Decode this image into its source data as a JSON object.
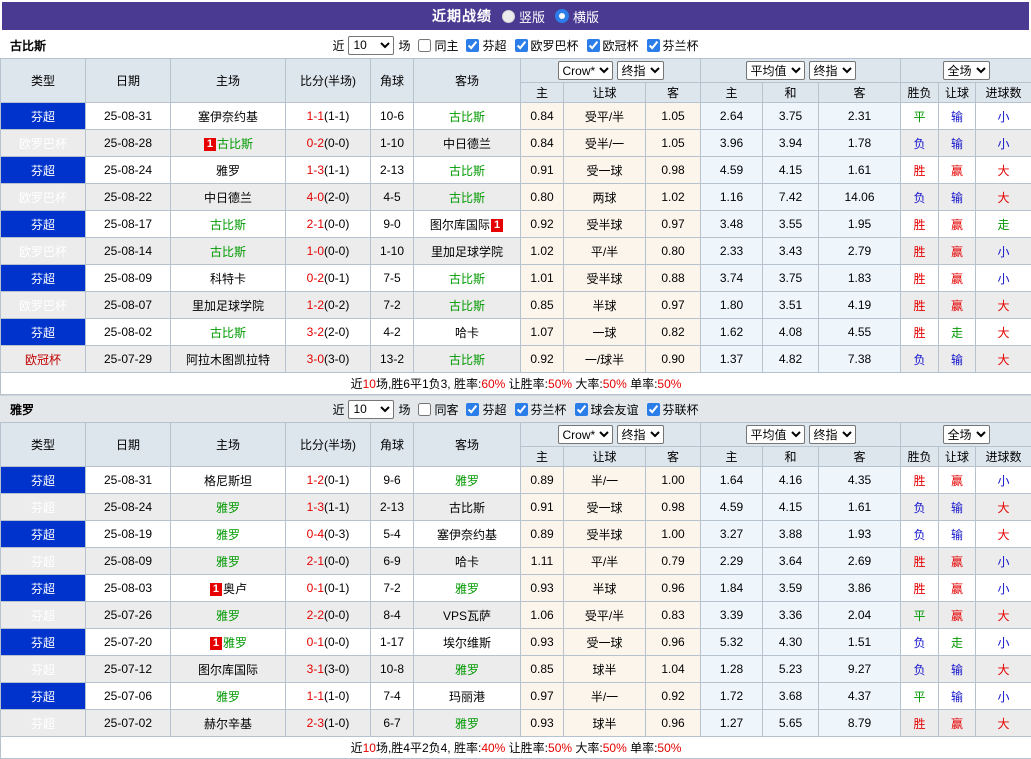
{
  "title_bar": {
    "title": "近期战绩",
    "radios": [
      {
        "label": "竖版",
        "selected": false
      },
      {
        "label": "横版",
        "selected": true
      }
    ]
  },
  "table_headers": {
    "left": [
      "类型",
      "日期",
      "主场",
      "比分(半场)",
      "角球",
      "客场"
    ],
    "groups": [
      {
        "selects": [
          "Crow*",
          "终指"
        ],
        "cols": [
          "主",
          "让球",
          "客"
        ],
        "tint": "crow"
      },
      {
        "selects": [
          "平均值",
          "终指"
        ],
        "cols": [
          "主",
          "和",
          "客"
        ],
        "tint": "avg"
      },
      {
        "selects": [
          "全场"
        ],
        "cols": [
          "胜负",
          "让球",
          "进球数"
        ],
        "tint": "plain"
      }
    ]
  },
  "colors": {
    "header_purple": "#4a3a91",
    "win_red": "#e60000",
    "lose_blue": "#1414cc",
    "draw_green": "#009900",
    "team_green": "#009900",
    "type_fincup_blue": "#0033cc",
    "type_europa_purple": "#7d00e0",
    "type_ucl_orange": "#ff4800"
  },
  "type_colors": {
    "芬超": "blue",
    "欧罗巴杯": "purple",
    "欧冠杯": "orange",
    "芬兰杯": "blue"
  },
  "result_colors": {
    "胜": "red",
    "赢": "red",
    "大": "red",
    "负": "blue",
    "输": "blue",
    "小": "blue",
    "平": "green",
    "走": "green"
  },
  "sections": [
    {
      "team": "古比斯",
      "filter": {
        "near": "近",
        "count": "10",
        "games": "场",
        "same": "同主",
        "same_checked": false,
        "leagues": [
          "芬超",
          "欧罗巴杯",
          "欧冠杯",
          "芬兰杯"
        ]
      },
      "rows": [
        {
          "type": "芬超",
          "date": "25-08-31",
          "home": {
            "text": "塞伊奈约基"
          },
          "score": {
            "ft": "1-1",
            "ht": "(1-1)"
          },
          "corner": "10-6",
          "away": {
            "text": "古比斯",
            "green": true
          },
          "crow": [
            "0.84",
            "受平/半",
            "1.05"
          ],
          "avg": [
            "2.64",
            "3.75",
            "2.31"
          ],
          "result": [
            "平",
            "输",
            "小"
          ]
        },
        {
          "type": "欧罗巴杯",
          "date": "25-08-28",
          "home": {
            "badge_before": "1",
            "text": "古比斯",
            "green": true
          },
          "score": {
            "ft": "0-2",
            "ht": "(0-0)"
          },
          "corner": "1-10",
          "away": {
            "text": "中日德兰"
          },
          "crow": [
            "0.84",
            "受半/一",
            "1.05"
          ],
          "avg": [
            "3.96",
            "3.94",
            "1.78"
          ],
          "result": [
            "负",
            "输",
            "小"
          ]
        },
        {
          "type": "芬超",
          "date": "25-08-24",
          "home": {
            "text": "雅罗"
          },
          "score": {
            "ft": "1-3",
            "ht": "(1-1)"
          },
          "corner": "2-13",
          "away": {
            "text": "古比斯",
            "green": true
          },
          "crow": [
            "0.91",
            "受一球",
            "0.98"
          ],
          "avg": [
            "4.59",
            "4.15",
            "1.61"
          ],
          "result": [
            "胜",
            "赢",
            "大"
          ]
        },
        {
          "type": "欧罗巴杯",
          "date": "25-08-22",
          "home": {
            "text": "中日德兰"
          },
          "score": {
            "ft": "4-0",
            "ht": "(2-0)"
          },
          "corner": "4-5",
          "away": {
            "text": "古比斯",
            "green": true
          },
          "crow": [
            "0.80",
            "两球",
            "1.02"
          ],
          "avg": [
            "1.16",
            "7.42",
            "14.06"
          ],
          "result": [
            "负",
            "输",
            "大"
          ]
        },
        {
          "type": "芬超",
          "date": "25-08-17",
          "home": {
            "text": "古比斯",
            "green": true
          },
          "score": {
            "ft": "2-1",
            "ht": "(0-0)"
          },
          "corner": "9-0",
          "away": {
            "text": "图尔库国际",
            "badge_after": "1"
          },
          "crow": [
            "0.92",
            "受半球",
            "0.97"
          ],
          "avg": [
            "3.48",
            "3.55",
            "1.95"
          ],
          "result": [
            "胜",
            "赢",
            "走"
          ]
        },
        {
          "type": "欧罗巴杯",
          "date": "25-08-14",
          "home": {
            "text": "古比斯",
            "green": true
          },
          "score": {
            "ft": "1-0",
            "ht": "(0-0)"
          },
          "corner": "1-10",
          "away": {
            "text": "里加足球学院"
          },
          "crow": [
            "1.02",
            "平/半",
            "0.80"
          ],
          "avg": [
            "2.33",
            "3.43",
            "2.79"
          ],
          "result": [
            "胜",
            "赢",
            "小"
          ]
        },
        {
          "type": "芬超",
          "date": "25-08-09",
          "home": {
            "text": "科特卡"
          },
          "score": {
            "ft": "0-2",
            "ht": "(0-1)"
          },
          "corner": "7-5",
          "away": {
            "text": "古比斯",
            "green": true
          },
          "crow": [
            "1.01",
            "受半球",
            "0.88"
          ],
          "avg": [
            "3.74",
            "3.75",
            "1.83"
          ],
          "result": [
            "胜",
            "赢",
            "小"
          ]
        },
        {
          "type": "欧罗巴杯",
          "date": "25-08-07",
          "home": {
            "text": "里加足球学院"
          },
          "score": {
            "ft": "1-2",
            "ht": "(0-2)"
          },
          "corner": "7-2",
          "away": {
            "text": "古比斯",
            "green": true
          },
          "crow": [
            "0.85",
            "半球",
            "0.97"
          ],
          "avg": [
            "1.80",
            "3.51",
            "4.19"
          ],
          "result": [
            "胜",
            "赢",
            "大"
          ]
        },
        {
          "type": "芬超",
          "date": "25-08-02",
          "home": {
            "text": "古比斯",
            "green": true
          },
          "score": {
            "ft": "3-2",
            "ht": "(2-0)"
          },
          "corner": "4-2",
          "away": {
            "text": "哈卡"
          },
          "crow": [
            "1.07",
            "一球",
            "0.82"
          ],
          "avg": [
            "1.62",
            "4.08",
            "4.55"
          ],
          "result": [
            "胜",
            "走",
            "大"
          ]
        },
        {
          "type": "欧冠杯",
          "date": "25-07-29",
          "home": {
            "text": "阿拉木图凯拉特"
          },
          "score": {
            "ft": "3-0",
            "ht": "(3-0)"
          },
          "corner": "13-2",
          "away": {
            "text": "古比斯",
            "green": true
          },
          "crow": [
            "0.92",
            "一/球半",
            "0.90"
          ],
          "avg": [
            "1.37",
            "4.82",
            "7.38"
          ],
          "result": [
            "负",
            "输",
            "大"
          ]
        }
      ],
      "summary": [
        {
          "t": "近"
        },
        {
          "t": "10",
          "red": true
        },
        {
          "t": "场,胜6平1负3, 胜率:"
        },
        {
          "t": "60%",
          "red": true
        },
        {
          "t": " 让胜率:"
        },
        {
          "t": "50%",
          "red": true
        },
        {
          "t": " 大率:"
        },
        {
          "t": "50%",
          "red": true
        },
        {
          "t": " 单率:"
        },
        {
          "t": "50%",
          "red": true
        }
      ]
    },
    {
      "team": "雅罗",
      "filter": {
        "near": "近",
        "count": "10",
        "games": "场",
        "same": "同客",
        "same_checked": false,
        "leagues": [
          "芬超",
          "芬兰杯",
          "球会友谊",
          "芬联杯"
        ]
      },
      "rows": [
        {
          "type": "芬超",
          "date": "25-08-31",
          "home": {
            "text": "格尼斯坦"
          },
          "score": {
            "ft": "1-2",
            "ht": "(0-1)"
          },
          "corner": "9-6",
          "away": {
            "text": "雅罗",
            "green": true
          },
          "crow": [
            "0.89",
            "半/一",
            "1.00"
          ],
          "avg": [
            "1.64",
            "4.16",
            "4.35"
          ],
          "result": [
            "胜",
            "赢",
            "小"
          ]
        },
        {
          "type": "芬超",
          "date": "25-08-24",
          "home": {
            "text": "雅罗",
            "green": true
          },
          "score": {
            "ft": "1-3",
            "ht": "(1-1)"
          },
          "corner": "2-13",
          "away": {
            "text": "古比斯"
          },
          "crow": [
            "0.91",
            "受一球",
            "0.98"
          ],
          "avg": [
            "4.59",
            "4.15",
            "1.61"
          ],
          "result": [
            "负",
            "输",
            "大"
          ]
        },
        {
          "type": "芬超",
          "date": "25-08-19",
          "home": {
            "text": "雅罗",
            "green": true
          },
          "score": {
            "ft": "0-4",
            "ht": "(0-3)"
          },
          "corner": "5-4",
          "away": {
            "text": "塞伊奈约基"
          },
          "crow": [
            "0.89",
            "受半球",
            "1.00"
          ],
          "avg": [
            "3.27",
            "3.88",
            "1.93"
          ],
          "result": [
            "负",
            "输",
            "大"
          ]
        },
        {
          "type": "芬超",
          "date": "25-08-09",
          "home": {
            "text": "雅罗",
            "green": true
          },
          "score": {
            "ft": "2-1",
            "ht": "(0-0)"
          },
          "corner": "6-9",
          "away": {
            "text": "哈卡"
          },
          "crow": [
            "1.11",
            "平/半",
            "0.79"
          ],
          "avg": [
            "2.29",
            "3.64",
            "2.69"
          ],
          "result": [
            "胜",
            "赢",
            "小"
          ]
        },
        {
          "type": "芬超",
          "date": "25-08-03",
          "home": {
            "badge_before": "1",
            "text": "奥卢"
          },
          "score": {
            "ft": "0-1",
            "ht": "(0-1)"
          },
          "corner": "7-2",
          "away": {
            "text": "雅罗",
            "green": true
          },
          "crow": [
            "0.93",
            "半球",
            "0.96"
          ],
          "avg": [
            "1.84",
            "3.59",
            "3.86"
          ],
          "result": [
            "胜",
            "赢",
            "小"
          ]
        },
        {
          "type": "芬超",
          "date": "25-07-26",
          "home": {
            "text": "雅罗",
            "green": true
          },
          "score": {
            "ft": "2-2",
            "ht": "(0-0)"
          },
          "corner": "8-4",
          "away": {
            "text": "VPS瓦萨"
          },
          "crow": [
            "1.06",
            "受平/半",
            "0.83"
          ],
          "avg": [
            "3.39",
            "3.36",
            "2.04"
          ],
          "result": [
            "平",
            "赢",
            "大"
          ]
        },
        {
          "type": "芬超",
          "date": "25-07-20",
          "home": {
            "badge_before": "1",
            "text": "雅罗",
            "green": true
          },
          "score": {
            "ft": "0-1",
            "ht": "(0-0)"
          },
          "corner": "1-17",
          "away": {
            "text": "埃尔维斯"
          },
          "crow": [
            "0.93",
            "受一球",
            "0.96"
          ],
          "avg": [
            "5.32",
            "4.30",
            "1.51"
          ],
          "result": [
            "负",
            "走",
            "小"
          ]
        },
        {
          "type": "芬超",
          "date": "25-07-12",
          "home": {
            "text": "图尔库国际"
          },
          "score": {
            "ft": "3-1",
            "ht": "(3-0)"
          },
          "corner": "10-8",
          "away": {
            "text": "雅罗",
            "green": true
          },
          "crow": [
            "0.85",
            "球半",
            "1.04"
          ],
          "avg": [
            "1.28",
            "5.23",
            "9.27"
          ],
          "result": [
            "负",
            "输",
            "大"
          ]
        },
        {
          "type": "芬超",
          "date": "25-07-06",
          "home": {
            "text": "雅罗",
            "green": true
          },
          "score": {
            "ft": "1-1",
            "ht": "(1-0)"
          },
          "corner": "7-4",
          "away": {
            "text": "玛丽港"
          },
          "crow": [
            "0.97",
            "半/一",
            "0.92"
          ],
          "avg": [
            "1.72",
            "3.68",
            "4.37"
          ],
          "result": [
            "平",
            "输",
            "小"
          ]
        },
        {
          "type": "芬超",
          "date": "25-07-02",
          "home": {
            "text": "赫尔辛基"
          },
          "score": {
            "ft": "2-3",
            "ht": "(1-0)"
          },
          "corner": "6-7",
          "away": {
            "text": "雅罗",
            "green": true
          },
          "crow": [
            "0.93",
            "球半",
            "0.96"
          ],
          "avg": [
            "1.27",
            "5.65",
            "8.79"
          ],
          "result": [
            "胜",
            "赢",
            "大"
          ]
        }
      ],
      "summary": [
        {
          "t": "近"
        },
        {
          "t": "10",
          "red": true
        },
        {
          "t": "场,胜4平2负4, 胜率:"
        },
        {
          "t": "40%",
          "red": true
        },
        {
          "t": " 让胜率:"
        },
        {
          "t": "50%",
          "red": true
        },
        {
          "t": " 大率:"
        },
        {
          "t": "50%",
          "red": true
        },
        {
          "t": " 单率:"
        },
        {
          "t": "50%",
          "red": true
        }
      ]
    }
  ]
}
